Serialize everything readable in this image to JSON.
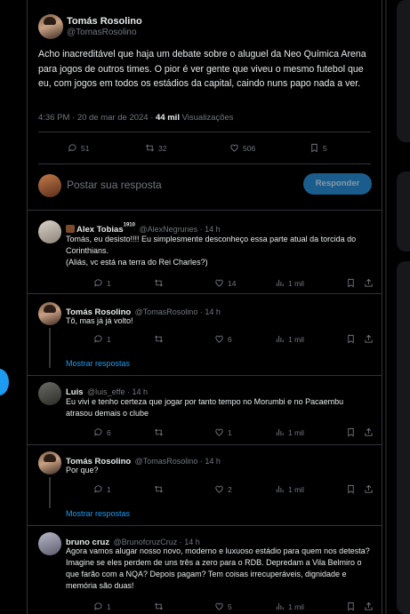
{
  "main_tweet": {
    "author_name": "Tomás Rosolino",
    "author_handle": "@TomasRosolino",
    "text": "Acho inacreditável que haja um debate sobre o aluguel da Neo Química Arena para jogos de outros times. O pior é ver gente que viveu o mesmo futebol que eu, com jogos em todos os estádios da capital, caindo nuns papo nada a ver.",
    "time": "4:36 PM · 20 de mar de 2024 · ",
    "views_count": "44 mil",
    "views_label": " Visualizações",
    "replies": "51",
    "retweets": "32",
    "likes": "506",
    "bookmarks": "5"
  },
  "composer": {
    "placeholder": "Postar sua resposta",
    "button_label": "Responder"
  },
  "replies": [
    {
      "author_name": "Alex Tobias",
      "author_sup": "1910",
      "author_handle": "@AlexNegrunes · 14 h",
      "text": "Tomás, eu desisto!!!! Eu simplesmente desconheço essa parte atual  da torcida do Corinthians.\n(Aliás, vc está na terra do Rei Charles?)",
      "replies": "1",
      "retweets": "",
      "likes": "14",
      "views": "1 mil"
    },
    {
      "author_name": "Tomás Rosolino",
      "author_handle": "@TomasRosolino · 14 h",
      "text": "Tô, mas já já volto!",
      "replies": "1",
      "retweets": "",
      "likes": "6",
      "views": "1 mil",
      "show_more": "Mostrar respostas"
    },
    {
      "author_name": "Luis",
      "author_handle": "@luis_effe · 14 h",
      "text": "Eu vivi e tenho certeza que jogar por tanto tempo no Morumbi e no Pacaembu atrasou demais o clube",
      "replies": "6",
      "retweets": "",
      "likes": "1",
      "views": "1 mil"
    },
    {
      "author_name": "Tomás Rosolino",
      "author_handle": "@TomasRosolino · 14 h",
      "text": "Por que?",
      "replies": "1",
      "retweets": "",
      "likes": "2",
      "views": "1 mil",
      "show_more": "Mostrar respostas"
    },
    {
      "author_name": "bruno cruz",
      "author_handle": "@BrunofcruzCruz · 14 h",
      "text": "Agora vamos alugar nosso novo, moderno e luxuoso estádio para quem nos detesta? Imagine se eles perdem de uns três a zero para o RDB. Depredam a Vila Belmiro o que farão com a NQA?  Depois pagam? Tem coisas irrecuperáveis, dignidade e memória são duas!",
      "replies": "1",
      "retweets": "",
      "likes": "5",
      "views": "1 mil"
    }
  ],
  "colors": {
    "background": "#000000",
    "accent": "#1d9bf0",
    "muted": "#71767b",
    "border": "#2f3336"
  }
}
